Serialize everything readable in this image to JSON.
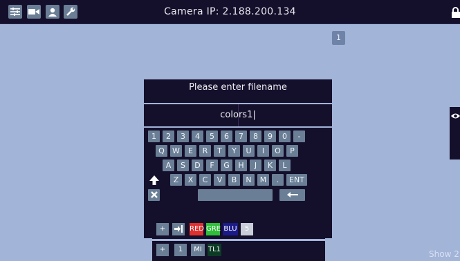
{
  "header": {
    "title": "Camera IP: 2.188.200.134",
    "icons": [
      "sliders-icon",
      "camera-icon",
      "user-icon",
      "wrench-icon"
    ]
  },
  "lock_icon": "lock-icon",
  "badge": "1",
  "dialog": {
    "title": "Please enter filename",
    "value": "colors1|",
    "rows": [
      [
        "1",
        "2",
        "3",
        "4",
        "5",
        "6",
        "7",
        "8",
        "9",
        "0",
        "-"
      ],
      [
        "Q",
        "W",
        "E",
        "R",
        "T",
        "Y",
        "U",
        "I",
        "O",
        "P"
      ],
      [
        "A",
        "S",
        "D",
        "F",
        "G",
        "H",
        "J",
        "K",
        "L"
      ],
      [
        "Z",
        "X",
        "C",
        "V",
        "B",
        "N",
        "M",
        ".",
        "ENT"
      ]
    ]
  },
  "bottom_panel_1": {
    "plus": "+",
    "red": "RED",
    "green": "GRE",
    "blue": "BLU",
    "five": "5"
  },
  "bottom_panel_2": {
    "plus": "+",
    "one": "1",
    "mi": "MI",
    "tl1": "TL1"
  },
  "footer": {
    "show": "Show 2"
  },
  "colors": {
    "bar": "#14102b",
    "key": "#6a7f96",
    "bg": "#a3b4d9",
    "red": "#e02f2f",
    "green": "#2fbf3a",
    "blue": "#1a1a8a"
  }
}
